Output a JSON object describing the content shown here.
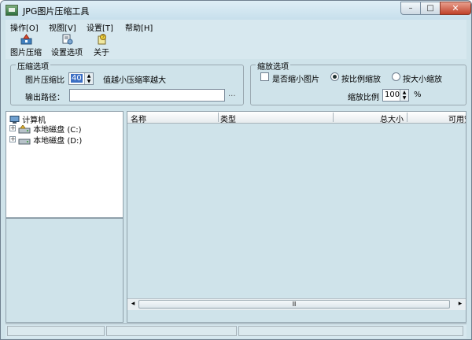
{
  "window": {
    "title": "JPG图片压缩工具",
    "controls": {
      "minimize": "–",
      "maximize": "□",
      "close": "✕"
    }
  },
  "menu": [
    {
      "label": "操作[O]"
    },
    {
      "label": "视图[V]"
    },
    {
      "label": "设置[T]"
    },
    {
      "label": "帮助[H]"
    }
  ],
  "toolbar": [
    {
      "label": "图片压缩",
      "icon": "compress-icon"
    },
    {
      "label": "设置选项",
      "icon": "settings-icon"
    },
    {
      "label": "关于",
      "icon": "about-icon"
    }
  ],
  "compression": {
    "group_label": "压缩选项",
    "ratio_label": "图片压缩比",
    "ratio_value": "40",
    "ratio_hint": "值越小压缩率越大",
    "output_label": "输出路径：",
    "output_value": "",
    "browse_label": "..."
  },
  "scaling": {
    "group_label": "缩放选项",
    "shrink_label": "是否缩小图片",
    "shrink_checked": false,
    "by_ratio_label": "按比例缩放",
    "by_size_label": "按大小缩放",
    "selected_mode": "by_ratio",
    "scale_label": "缩放比例",
    "scale_value": "100",
    "scale_unit": "%"
  },
  "tree": {
    "root": {
      "label": "计算机",
      "icon": "computer-icon"
    },
    "items": [
      {
        "label": "本地磁盘 (C:)",
        "icon": "drive-icon"
      },
      {
        "label": "本地磁盘 (D:)",
        "icon": "drive-icon"
      }
    ]
  },
  "file_list": {
    "columns": [
      "名称",
      "类型",
      "总大小",
      "可用空"
    ]
  },
  "scrollbar": {
    "left_arrow": "◂",
    "right_arrow": "▸",
    "thumb_grip": "Ⅲ"
  },
  "spinner": {
    "up": "▲",
    "down": "▼"
  },
  "tree_expander": "+",
  "status": [
    "",
    "",
    ""
  ]
}
